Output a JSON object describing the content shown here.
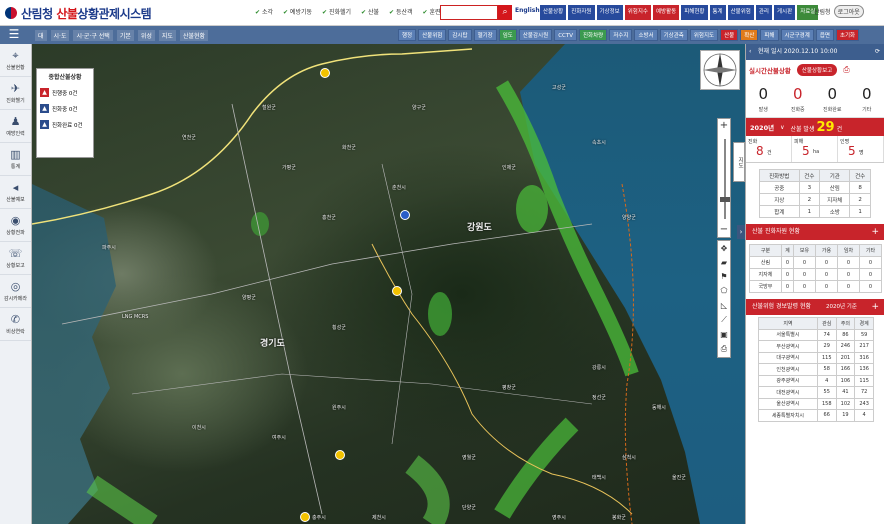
{
  "app": {
    "logo_agency": "산림청",
    "logo_red": "산불",
    "logo_rest": "상황관제시스템"
  },
  "filters": [
    "소각",
    "예방기동",
    "진화헬기",
    "산불",
    "등산객",
    "훈련"
  ],
  "search": {
    "placeholder": ""
  },
  "english_label": "English",
  "topnav": [
    {
      "label": "산불상황",
      "style": "blue"
    },
    {
      "label": "진화자원",
      "style": "blue"
    },
    {
      "label": "기상정보",
      "style": "blue"
    },
    {
      "label": "위험지수",
      "style": "red"
    },
    {
      "label": "예방활동",
      "style": "red"
    },
    {
      "label": "피해현황",
      "style": "blue"
    },
    {
      "label": "통계",
      "style": "blue"
    },
    {
      "label": "산불위험",
      "style": "blue"
    },
    {
      "label": "관리",
      "style": "blue"
    },
    {
      "label": "게시판",
      "style": "blue"
    },
    {
      "label": "자료실",
      "style": "green"
    }
  ],
  "user": {
    "name": "산림청",
    "logout": "로그아웃"
  },
  "toolbar": {
    "breadcrumb": [
      "대",
      "시·도",
      "시·군·구 선택",
      "기본",
      "위성",
      "지도",
      "산불현황"
    ],
    "layers": [
      {
        "label": "행정",
        "style": "blue"
      },
      {
        "label": "산불위험",
        "style": "blue"
      },
      {
        "label": "감시탑",
        "style": "blue"
      },
      {
        "label": "헬기장",
        "style": "blue"
      },
      {
        "label": "임도",
        "style": "g"
      },
      {
        "label": "산불감시원",
        "style": "blue"
      },
      {
        "label": "CCTV",
        "style": "blue"
      },
      {
        "label": "진화차량",
        "style": "g"
      },
      {
        "label": "저수지",
        "style": "blue"
      },
      {
        "label": "소방서",
        "style": "blue"
      },
      {
        "label": "기상관측",
        "style": "blue"
      },
      {
        "label": "위험지도",
        "style": "blue"
      },
      {
        "label": "산불",
        "style": "r"
      },
      {
        "label": "확산",
        "style": "o"
      },
      {
        "label": "피해",
        "style": "blue"
      },
      {
        "label": "시군구경계",
        "style": "blue"
      },
      {
        "label": "읍면",
        "style": "blue"
      },
      {
        "label": "초기화",
        "style": "r"
      }
    ]
  },
  "sidebar": [
    {
      "icon": "map-icon",
      "label": "산불현황"
    },
    {
      "icon": "helicopter-icon",
      "label": "진화헬기"
    },
    {
      "icon": "person-icon",
      "label": "예방인력"
    },
    {
      "icon": "chart-icon",
      "label": "통계"
    },
    {
      "icon": "speaker-icon",
      "label": "산불예보"
    },
    {
      "icon": "broadcast-icon",
      "label": "상황전파"
    },
    {
      "icon": "phone-icon",
      "label": "상황보고"
    },
    {
      "icon": "cctv-icon",
      "label": "감시카메라"
    },
    {
      "icon": "call-icon",
      "label": "비상연락"
    }
  ],
  "legend": {
    "title": "종합산불상황",
    "rows": [
      {
        "label": "진행중 0건",
        "style": "r"
      },
      {
        "label": "진화중 0건",
        "style": "b"
      },
      {
        "label": "진화완료 0건",
        "style": "b"
      }
    ]
  },
  "map_labels": [
    {
      "text": "강원도",
      "big": true
    },
    {
      "text": "경기도",
      "big": true
    },
    {
      "text": "춘천시",
      "big": false
    },
    {
      "text": "원주시",
      "big": false
    },
    {
      "text": "강릉시",
      "big": false
    },
    {
      "text": "홍천군",
      "big": false
    },
    {
      "text": "인제군",
      "big": false
    },
    {
      "text": "양양군",
      "big": false
    },
    {
      "text": "평창군",
      "big": false
    },
    {
      "text": "정선군",
      "big": false
    },
    {
      "text": "횡성군",
      "big": false
    },
    {
      "text": "삼척시",
      "big": false
    },
    {
      "text": "동해시",
      "big": false
    },
    {
      "text": "태백시",
      "big": false
    },
    {
      "text": "영월군",
      "big": false
    },
    {
      "text": "가평군",
      "big": false
    },
    {
      "text": "양평군",
      "big": false
    },
    {
      "text": "이천시",
      "big": false
    },
    {
      "text": "여주시",
      "big": false
    },
    {
      "text": "파주시",
      "big": false
    },
    {
      "text": "연천군",
      "big": false
    },
    {
      "text": "철원군",
      "big": false
    },
    {
      "text": "화천군",
      "big": false
    },
    {
      "text": "양구군",
      "big": false
    },
    {
      "text": "고성군",
      "big": false
    },
    {
      "text": "속초시",
      "big": false
    },
    {
      "text": "충주시",
      "big": false
    },
    {
      "text": "제천시",
      "big": false
    },
    {
      "text": "단양군",
      "big": false
    },
    {
      "text": "영주시",
      "big": false
    },
    {
      "text": "봉화군",
      "big": false
    },
    {
      "text": "울진군",
      "big": false
    },
    {
      "text": "LNG MCRS",
      "big": false
    }
  ],
  "right_panel": {
    "header_date": "현재 일시 2020.12.10 10:00",
    "status_title": "실시간산불상황",
    "status_button": "산불상황보고",
    "counts": [
      {
        "value": "0",
        "label": "발생",
        "red": false
      },
      {
        "value": "0",
        "label": "진화중",
        "red": true
      },
      {
        "value": "0",
        "label": "진화완료",
        "red": false
      },
      {
        "value": "0",
        "label": "기타",
        "red": false
      }
    ],
    "year": "2020년",
    "year_total_prefix": "산불 발생",
    "year_total": "29",
    "year_total_unit": "건",
    "year_stats": [
      {
        "key": "진화",
        "value": "8",
        "unit": "건"
      },
      {
        "key": "피해",
        "value": "5",
        "unit": "ha"
      },
      {
        "key": "인명",
        "value": "5",
        "unit": "명"
      }
    ],
    "mini_table": {
      "headers": [
        "진화방법",
        "건수",
        "기관",
        "건수"
      ],
      "rows": [
        [
          "공중",
          "3",
          "산림",
          "8"
        ],
        [
          "지상",
          "2",
          "지자체",
          "2"
        ],
        [
          "합계",
          "1",
          "소방",
          "1"
        ]
      ]
    },
    "section2": {
      "title": "산불 진화자원 현황",
      "headers": [
        "구분",
        "계",
        "보유",
        "가용",
        "임차",
        "기타"
      ],
      "subheaders": [
        "",
        "",
        "헬기",
        "인원",
        "",
        ""
      ],
      "rows": [
        [
          "산림",
          "0",
          "0",
          "0",
          "0",
          "0"
        ],
        [
          "지자체",
          "0",
          "0",
          "0",
          "0",
          "0"
        ],
        [
          "국방부",
          "0",
          "0",
          "0",
          "0",
          "0"
        ]
      ]
    },
    "section3": {
      "title": "산불위험 경보발령 현황",
      "sub": "2020년 기준",
      "headers": [
        "지역",
        "관심",
        "주의",
        "경계"
      ],
      "rows": [
        [
          "서울특별시",
          "74",
          "86",
          "59"
        ],
        [
          "부산광역시",
          "29",
          "246",
          "217"
        ],
        [
          "대구광역시",
          "115",
          "201",
          "316"
        ],
        [
          "인천광역시",
          "58",
          "166",
          "136"
        ],
        [
          "광주광역시",
          "4",
          "106",
          "115"
        ],
        [
          "대전광역시",
          "55",
          "41",
          "72"
        ],
        [
          "울산광역시",
          "158",
          "102",
          "243"
        ],
        [
          "세종특별자치시",
          "66",
          "19",
          "4"
        ]
      ]
    }
  }
}
